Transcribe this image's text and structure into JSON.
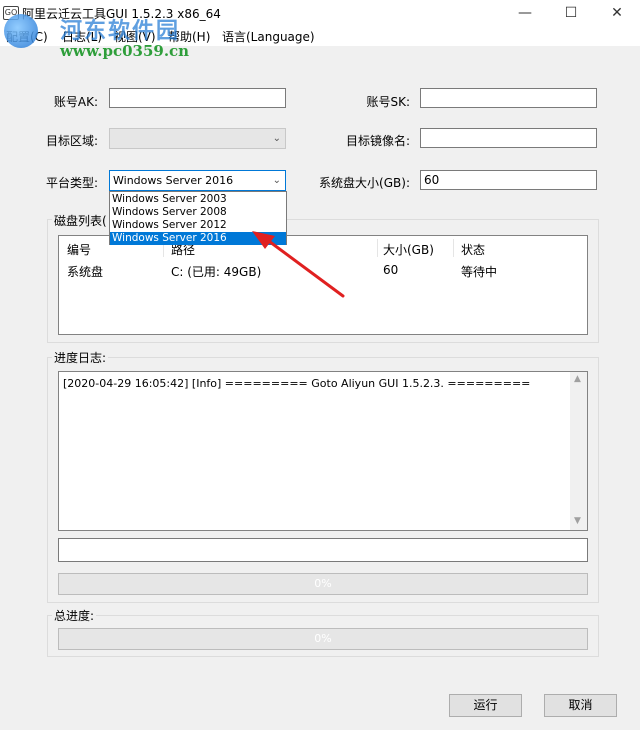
{
  "window": {
    "icon_text": "GO",
    "title": "阿里云迁云工具GUI 1.5.2.3 x86_64",
    "minimize": "—",
    "maximize": "☐",
    "close": "✕"
  },
  "menu": [
    "配置(C)",
    "日志(L)",
    "视图(V)",
    "帮助(H)",
    "语言(Language)"
  ],
  "watermark": {
    "title": "河东软件园",
    "url": "www.pc0359.cn"
  },
  "form": {
    "ak_label": "账号AK:",
    "ak_value": "",
    "sk_label": "账号SK:",
    "sk_value": "",
    "region_label": "目标区域:",
    "region_value": "",
    "image_name_label": "目标镜像名:",
    "image_name_value": "",
    "platform_label": "平台类型:",
    "platform_value": "Windows Server 2016",
    "disk_size_label": "系统盘大小(GB):",
    "disk_size_value": "60"
  },
  "platform_options": [
    "Windows Server 2003",
    "Windows Server 2008",
    "Windows Server 2012",
    "Windows Server 2016"
  ],
  "disk_list": {
    "title": "磁盘列表(",
    "columns": [
      "编号",
      "路径",
      "大小(GB)",
      "状态"
    ],
    "rows": [
      [
        "系统盘",
        "C: (已用: 49GB)",
        "60",
        "等待中"
      ]
    ]
  },
  "progress_log": {
    "title": "进度日志:",
    "lines": [
      "[2020-04-29 16:05:42] [Info]  ========= Goto Aliyun GUI 1.5.2.3. ========="
    ],
    "status_value": "",
    "progress_text": "0%",
    "progress": 0
  },
  "total_progress": {
    "title": "总进度:",
    "progress_text": "0%",
    "progress": 0
  },
  "buttons": {
    "run": "运行",
    "cancel": "取消"
  },
  "colors": {
    "selection": "#0078d7",
    "annotation_arrow": "#e02020"
  }
}
